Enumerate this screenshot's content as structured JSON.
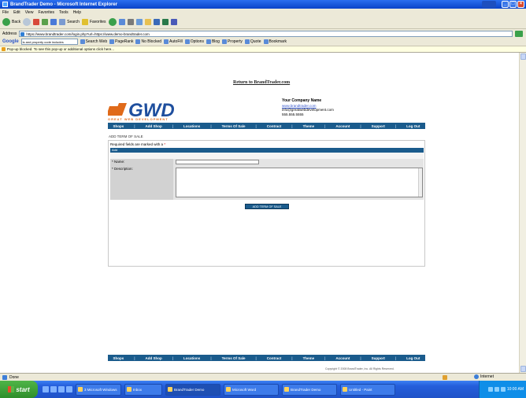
{
  "window": {
    "title": "BrandTrader Demo - Microsoft Internet Explorer"
  },
  "menubar": [
    "File",
    "Edit",
    "View",
    "Favorites",
    "Tools",
    "Help"
  ],
  "toolbar": {
    "back_label": "Back",
    "search_label": "Search",
    "favorites_label": "Favorites"
  },
  "address": {
    "label": "Address",
    "url": "https://www.brandtrader.com/login.php?url=https://www.demo-brandtrader.com"
  },
  "google": {
    "logo": "Google",
    "search_value": "is and property code includes",
    "items": [
      "Search Web",
      "PageRank",
      "No Blocked",
      "AutoFill",
      "Options",
      "Blog",
      "Property",
      "Quote",
      "Bookmark"
    ]
  },
  "infobar": {
    "text": "Pop-up blocked. To see this pop-up or additional options click here..."
  },
  "page": {
    "return_link": "Return to BrandTrader.com",
    "logo_text": "GWD",
    "tagline": "GREAT WEB DEVELOPMENT",
    "company": {
      "name": "Your Company Name",
      "url": "www.brandtrader.com",
      "email": "info@greatwebdevelopment.com",
      "phone": "555.555.5555"
    },
    "nav": [
      "Shops",
      "Add Shop",
      "Locations",
      "Terms Of Sale",
      "Contract",
      "Theme",
      "Account",
      "Support",
      "Log Out"
    ],
    "section_title": "ADD TERM OF SALE",
    "required_note": "Required fields are marked with a",
    "required_star": "*",
    "form_header": "Add",
    "name_label": "* Name:",
    "description_label": "* Description:",
    "submit_label": "ADD TERM OF SALE",
    "copyright": "Copyright © 2008 BrandTrader, Inc. All Rights Reserved."
  },
  "statusbar": {
    "text": "Done",
    "zone": "Internet"
  },
  "taskbar": {
    "start_label": "start",
    "tasks": [
      "3 Microsoft Windows",
      "Inbox",
      "BrandTrader Demo",
      "Microsoft Word",
      "BrandTrader Demo",
      "Untitled - Paint"
    ],
    "clock": "10:00 AM"
  },
  "colors": {
    "nav_blue": "#1a5b8c",
    "logo_orange": "#e06a1a",
    "logo_blue": "#1f4f9e"
  }
}
